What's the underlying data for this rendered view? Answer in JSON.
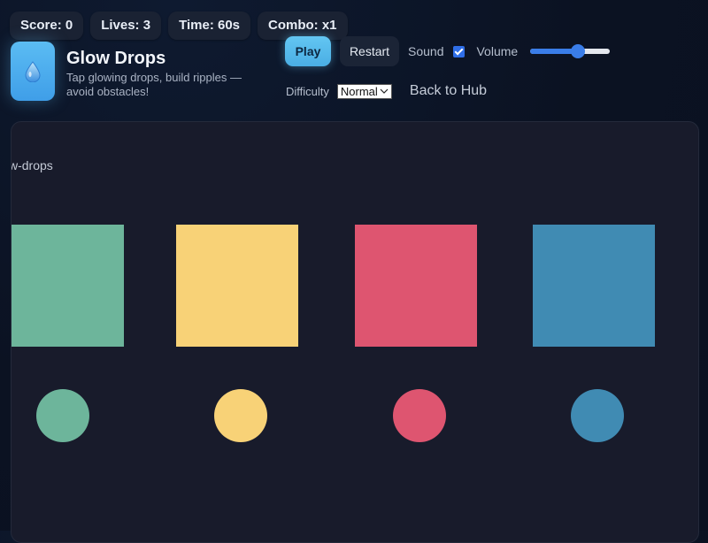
{
  "stats": {
    "score": "Score: 0",
    "lives": "Lives: 3",
    "time": "Time: 60s",
    "combo": "Combo: x1"
  },
  "header": {
    "icon": "water-drop-icon",
    "title": "Glow Drops",
    "subtitle": "Tap glowing drops, build ripples — avoid obstacles!"
  },
  "controls": {
    "play_label": "Play",
    "restart_label": "Restart",
    "sound_label": "Sound",
    "sound_checked": true,
    "volume_label": "Volume",
    "volume_level": 0.6,
    "difficulty_label": "Difficulty",
    "difficulty_value": "Normal",
    "back_label": "Back to Hub"
  },
  "canvas": {
    "label": "w-drops",
    "palette": [
      {
        "name": "green",
        "color": "#6db59b"
      },
      {
        "name": "yellow",
        "color": "#f8d277"
      },
      {
        "name": "red",
        "color": "#de5570"
      },
      {
        "name": "blue",
        "color": "#408bb3"
      }
    ]
  },
  "colors": {
    "accent": "#4aaee4",
    "background": "#0b1222",
    "canvas": "#181b2b",
    "chip": "#1a2233"
  }
}
